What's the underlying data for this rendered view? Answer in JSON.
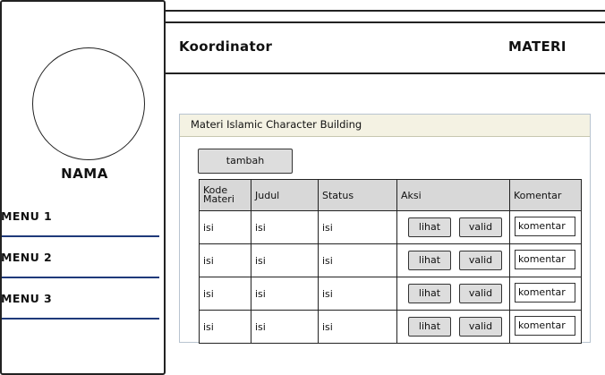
{
  "sidebar": {
    "name": "NAMA",
    "menu": [
      {
        "label": "MENU 1"
      },
      {
        "label": "MENU 2"
      },
      {
        "label": "MENU 3"
      }
    ]
  },
  "header": {
    "role": "Koordinator",
    "section": "MATERI"
  },
  "panel": {
    "title": "Materi Islamic Character Building",
    "add_button": "tambah",
    "columns": [
      "Kode Materi",
      "Judul",
      "Status",
      "Aksi",
      "Komentar"
    ],
    "rows": [
      {
        "kode": "isi",
        "judul": "isi",
        "status": "isi"
      },
      {
        "kode": "isi",
        "judul": "isi",
        "status": "isi"
      },
      {
        "kode": "isi",
        "judul": "isi",
        "status": "isi"
      },
      {
        "kode": "isi",
        "judul": "isi",
        "status": "isi"
      }
    ],
    "actions": {
      "view": "lihat",
      "validate": "valid"
    },
    "comment_value": "komentar"
  },
  "colors": {
    "border": "#222222",
    "menu_line": "#1f3a7a",
    "panel_head": "#f4f2e3",
    "button": "#dddddd"
  }
}
